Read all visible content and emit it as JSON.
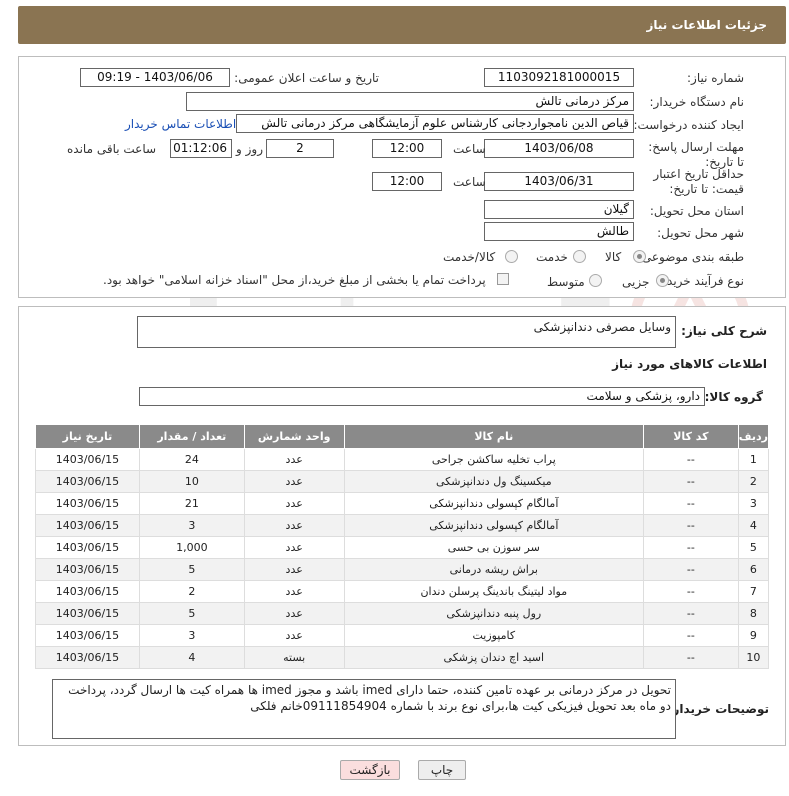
{
  "header": {
    "title": "جزئیات اطلاعات نیاز"
  },
  "form": {
    "need_number_label": "شماره نیاز:",
    "need_number": "1103092181000015",
    "announce_label": "تاریخ و ساعت اعلان عمومی:",
    "announce_value": "1403/06/06 - 09:19",
    "buyer_org_label": "نام دستگاه خریدار:",
    "buyer_org": "مرکز درمانی تالش",
    "creator_label": "ایجاد کننده درخواست:",
    "creator": "قیاص الدین نامجواردجانی کارشناس علوم آزمایشگاهی مرکز درمانی تالش",
    "contact_link": "اطلاعات تماس خریدار",
    "deadline_label": "مهلت ارسال پاسخ: تا تاریخ:",
    "deadline_date": "1403/06/08",
    "time_label": "ساعت",
    "deadline_time": "12:00",
    "days_value": "2",
    "days_label": "روز و",
    "remaining_time": "01:12:06",
    "remaining_label": "ساعت باقی مانده",
    "validity_label": "حداقل تاریخ اعتبار قیمت: تا تاریخ:",
    "validity_date": "1403/06/31",
    "validity_time_label": "ساعت",
    "validity_time": "12:00",
    "province_label": "استان محل تحویل:",
    "province": "گیلان",
    "city_label": "شهر محل تحویل:",
    "city": "طالش",
    "category_label": "طبقه بندی موضوعی:",
    "category_options": [
      "کالا",
      "خدمت",
      "کالا/خدمت"
    ],
    "purchase_type_label": "نوع فرآیند خرید :",
    "purchase_options": [
      "جزیی",
      "متوسط"
    ],
    "payment_note": "پرداخت تمام یا بخشی از مبلغ خرید،از محل \"اسناد خزانه اسلامی\" خواهد بود."
  },
  "section2": {
    "summary_label": "شرح کلی نیاز:",
    "summary": "وسایل مصرفی دندانپزشکی",
    "goods_info_title": "اطلاعات کالاهای مورد نیاز",
    "goods_group_label": "گروه کالا:",
    "goods_group": "دارو، پزشکی و سلامت"
  },
  "table": {
    "headers": [
      "ردیف",
      "کد کالا",
      "نام کالا",
      "واحد شمارش",
      "تعداد / مقدار",
      "تاریخ نیاز"
    ],
    "rows": [
      [
        "1",
        "--",
        "پراب تخلیه ساکشن جراحی",
        "عدد",
        "24",
        "1403/06/15"
      ],
      [
        "2",
        "--",
        "میکسینگ ول دندانپزشکی",
        "عدد",
        "10",
        "1403/06/15"
      ],
      [
        "3",
        "--",
        "آمالگام کپسولی دندانپزشکی",
        "عدد",
        "21",
        "1403/06/15"
      ],
      [
        "4",
        "--",
        "آمالگام کپسولی دندانپزشکی",
        "عدد",
        "3",
        "1403/06/15"
      ],
      [
        "5",
        "--",
        "سر سوزن بی حسی",
        "عدد",
        "1,000",
        "1403/06/15"
      ],
      [
        "6",
        "--",
        "براش ریشه درمانی",
        "عدد",
        "5",
        "1403/06/15"
      ],
      [
        "7",
        "--",
        "مواد لیتینگ باندینگ پرسلن دندان",
        "عدد",
        "2",
        "1403/06/15"
      ],
      [
        "8",
        "--",
        "رول پنبه دندانپزشکی",
        "عدد",
        "5",
        "1403/06/15"
      ],
      [
        "9",
        "--",
        "کامپوزیت",
        "عدد",
        "3",
        "1403/06/15"
      ],
      [
        "10",
        "--",
        "اسید اچ دندان پزشکی",
        "بسته",
        "4",
        "1403/06/15"
      ]
    ]
  },
  "buyer_notes": {
    "label": "توضیحات خریدار:",
    "text": "تحویل در مرکز درمانی بر عهده تامین کننده، حتما دارای imed باشد و مجوز imed ها همراه کیت ها ارسال گردد، پرداخت دو ماه بعد تحویل فیزیکی کیت ها،برای نوع برند با شماره 09111854904خانم فلکی"
  },
  "buttons": {
    "print": "چاپ",
    "back": "بازگشت"
  },
  "watermark": {
    "text": "AriaTender.neT"
  },
  "colors": {
    "header_bg": "#8a7452",
    "table_header_bg": "#8a8a8a",
    "link": "#1a4fb5",
    "back_button_bg": "#fbdede"
  }
}
